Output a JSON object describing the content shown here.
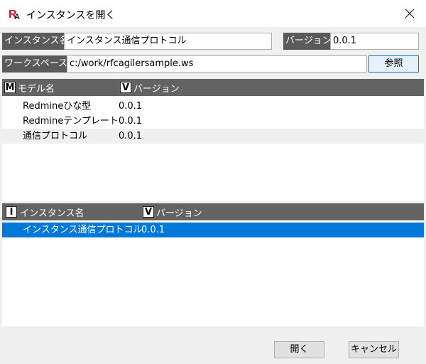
{
  "window": {
    "title": "インスタンスを開く",
    "close_glyph": "✕"
  },
  "form": {
    "instance_name_label": "インスタンス名",
    "instance_name_value": "インスタンス通信プロトコル",
    "version_label": "バージョン",
    "version_value": "0.0.1",
    "workspace_label": "ワークスペース",
    "workspace_value": "c:/work/rfcagilersample.ws",
    "browse_label": "参照"
  },
  "models_table": {
    "icon_model": "M",
    "col_model": "モデル名",
    "icon_version": "V",
    "col_version": "バージョン",
    "rows": [
      {
        "name": "Redmineひな型",
        "version": "0.0.1"
      },
      {
        "name": "Redmineテンプレート",
        "version": "0.0.1"
      },
      {
        "name": "通信プロトコル",
        "version": "0.0.1"
      }
    ]
  },
  "instances_table": {
    "icon_instance": "I",
    "col_instance": "インスタンス名",
    "icon_version": "V",
    "col_version": "バージョン",
    "rows": [
      {
        "name": "インスタンス通信プロトコル",
        "version": "0.0.1"
      }
    ]
  },
  "buttons": {
    "open": "開く",
    "cancel": "キャンセル"
  },
  "colors": {
    "header_bg": "#636363",
    "selection": "#0078d7",
    "accent_red": "#c8102e"
  }
}
